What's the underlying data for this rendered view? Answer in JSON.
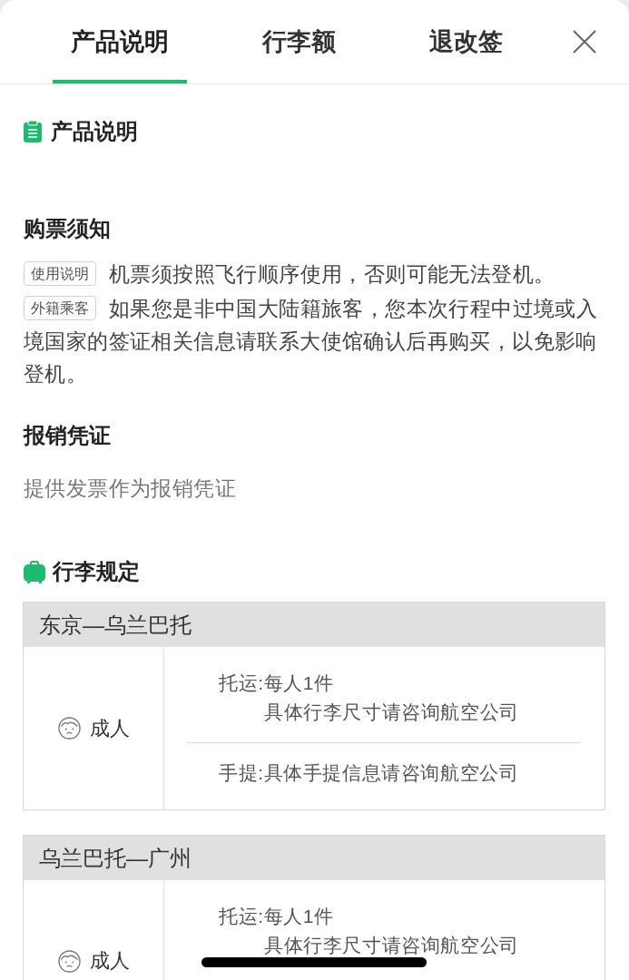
{
  "tabs": [
    {
      "label": "产品说明",
      "selected": true
    },
    {
      "label": "行李额",
      "selected": false
    },
    {
      "label": "退改签",
      "selected": false
    }
  ],
  "product_section": {
    "title": "产品说明"
  },
  "purchase_notice": {
    "title": "购票须知",
    "notes": [
      {
        "tag": "使用说明",
        "text": "机票须按照飞行顺序使用，否则可能无法登机。"
      },
      {
        "tag": "外籍乘客",
        "text": "如果您是非中国大陆籍旅客，您本次行程中过境或入境国家的签证相关信息请联系大使馆确认后再购买，以免影响登机。"
      }
    ]
  },
  "reimbursement": {
    "title": "报销凭证",
    "text": "提供发票作为报销凭证"
  },
  "baggage_section": {
    "title": "行李规定",
    "routes": [
      {
        "route": "东京—乌兰巴托",
        "passenger": "成人",
        "rules": [
          {
            "text": "托运:每人1件",
            "detail": "具体行李尺寸请咨询航空公司"
          },
          {
            "text": "手提:具体手提信息请咨询航空公司"
          }
        ]
      },
      {
        "route": "乌兰巴托—广州",
        "passenger": "成人",
        "rules": [
          {
            "text": "托运:每人1件",
            "detail": "具体行李尺寸请咨询航空公司"
          }
        ]
      }
    ]
  }
}
